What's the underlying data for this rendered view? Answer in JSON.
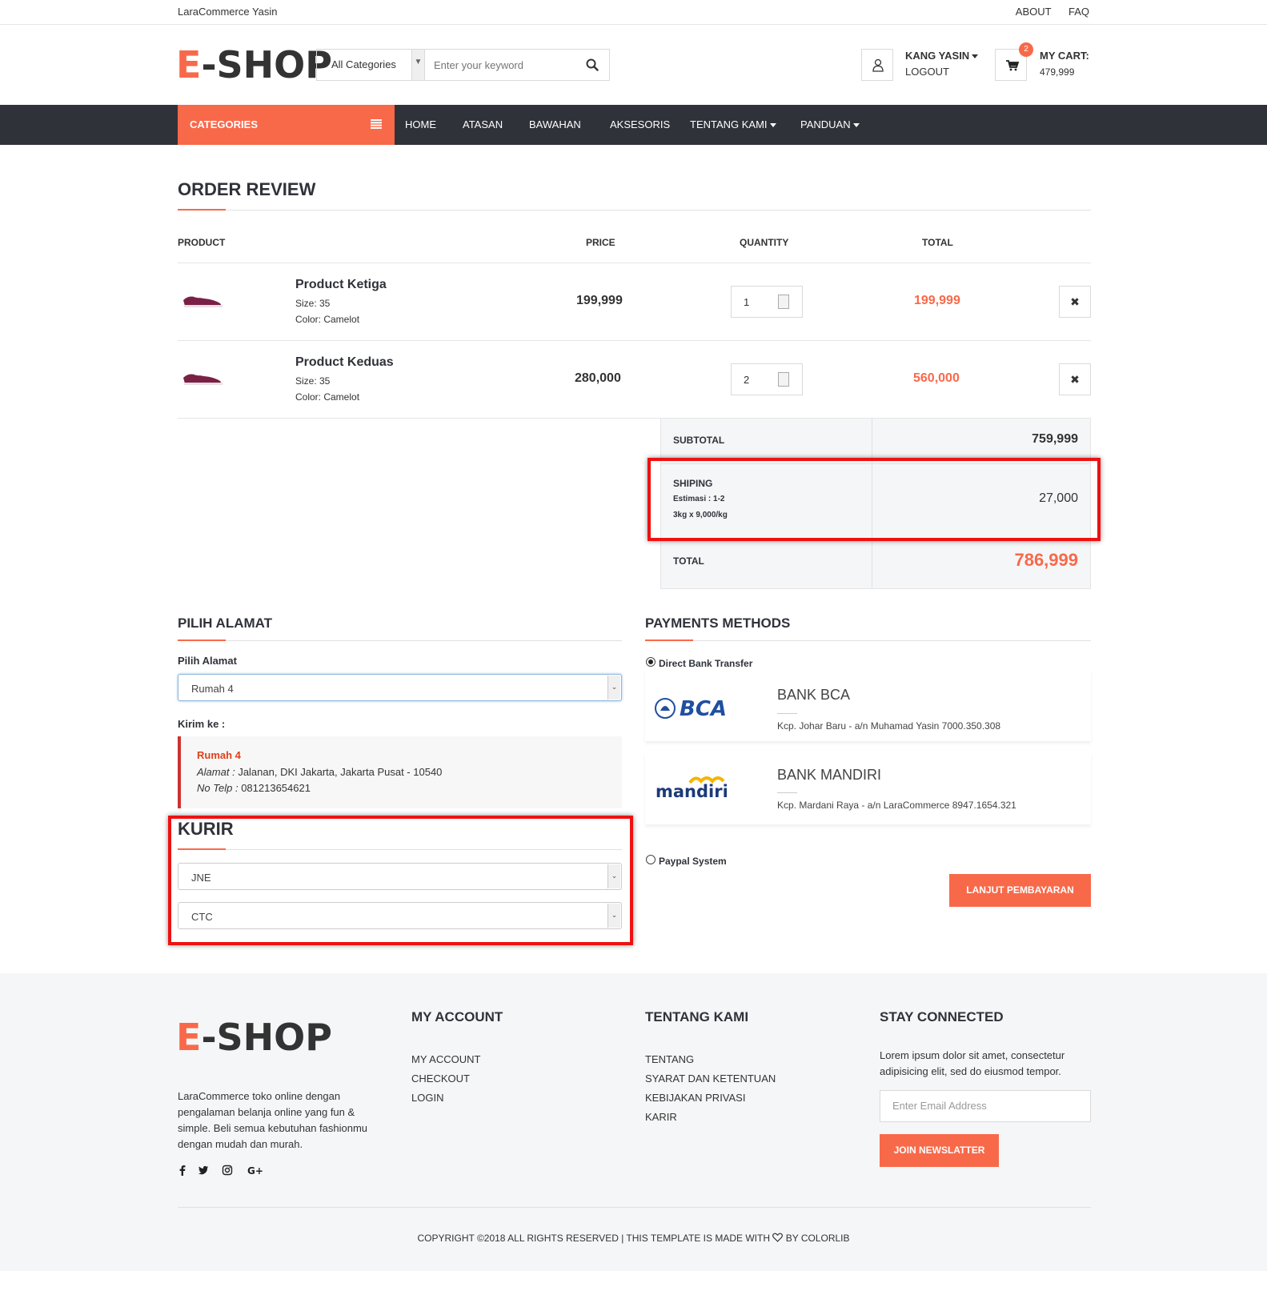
{
  "topbar": {
    "site_name": "LaraCommerce Yasin",
    "about": "ABOUT",
    "faq": "FAQ"
  },
  "header": {
    "logo_e": "E",
    "logo_rest": "-SHOP",
    "search_category": "All Categories",
    "search_placeholder": "Enter your keyword",
    "account_name": "KANG YASIN",
    "logout": "LOGOUT",
    "cart_count": "2",
    "cart_label": "MY CART:",
    "cart_amount": "479,999"
  },
  "nav": {
    "categories": "CATEGORIES",
    "items": [
      "HOME",
      "ATASAN",
      "BAWAHAN",
      "AKSESORIS",
      "TENTANG KAMI",
      "PANDUAN"
    ]
  },
  "order": {
    "title": "ORDER REVIEW",
    "headers": {
      "product": "PRODUCT",
      "price": "PRICE",
      "quantity": "QUANTITY",
      "total": "TOTAL"
    },
    "items": [
      {
        "name": "Product Ketiga",
        "size": "Size: 35",
        "color": "Color: Camelot",
        "price": "199,999",
        "qty": "1",
        "total": "199,999",
        "remove": "✖"
      },
      {
        "name": "Product Keduas",
        "size": "Size: 35",
        "color": "Color: Camelot",
        "price": "280,000",
        "qty": "2",
        "total": "560,000",
        "remove": "✖"
      }
    ],
    "subtotal_label": "SUBTOTAL",
    "subtotal": "759,999",
    "shipping_label": "SHIPING",
    "shipping_estimate": "Estimasi : 1-2",
    "shipping_calc": "3kg x 9,000/kg",
    "shipping": "27,000",
    "total_label": "TOTAL",
    "total": "786,999"
  },
  "address": {
    "title": "PILIH ALAMAT",
    "select_label": "Pilih Alamat",
    "selected": "Rumah 4",
    "send_to_label": "Kirim ke :",
    "name": "Rumah 4",
    "alamat_label": "Alamat :",
    "alamat": "Jalanan, DKI Jakarta, Jakarta Pusat - 10540",
    "telp_label": "No Telp :",
    "telp": "081213654621"
  },
  "courier": {
    "title": "KURIR",
    "courier": "JNE",
    "service": "CTC"
  },
  "payments": {
    "title": "PAYMENTS METHODS",
    "direct": "Direct Bank Transfer",
    "banks": [
      {
        "logo": "BCA",
        "name": "BANK BCA",
        "desc": "Kcp. Johar Baru - a/n Muhamad Yasin 7000.350.308"
      },
      {
        "logo": "mandiri",
        "name": "BANK MANDIRI",
        "desc": "Kcp. Mardani Raya - a/n LaraCommerce 8947.1654.321"
      }
    ],
    "paypal": "Paypal System",
    "proceed": "LANJUT PEMBAYARAN"
  },
  "footer": {
    "about_lines": [
      "LaraCommerce toko online dengan",
      "pengalaman belanja online yang fun &",
      "simple. Beli semua kebutuhan fashionmu",
      "dengan mudah dan murah."
    ],
    "my_account_title": "MY ACCOUNT",
    "my_account_links": [
      "MY ACCOUNT",
      "CHECKOUT",
      "LOGIN"
    ],
    "tentang_title": "TENTANG KAMI",
    "tentang_links": [
      "TENTANG",
      "SYARAT DAN KETENTUAN",
      "KEBIJAKAN PRIVASI",
      "KARIR"
    ],
    "stay_title": "STAY CONNECTED",
    "stay_lines": [
      "Lorem ipsum dolor sit amet, consectetur",
      "adipisicing elit, sed do eiusmod tempor."
    ],
    "email_placeholder": "Enter Email Address",
    "newsletter_button": "JOIN NEWSLATTER",
    "copyright_left": "COPYRIGHT ©2018 ALL RIGHTS RESERVED | THIS TEMPLATE IS MADE WITH",
    "copyright_right": "BY COLORLIB"
  },
  "colors": {
    "accent": "#F8694A",
    "nav_bg": "#30323A",
    "highlight": "#E11111"
  }
}
